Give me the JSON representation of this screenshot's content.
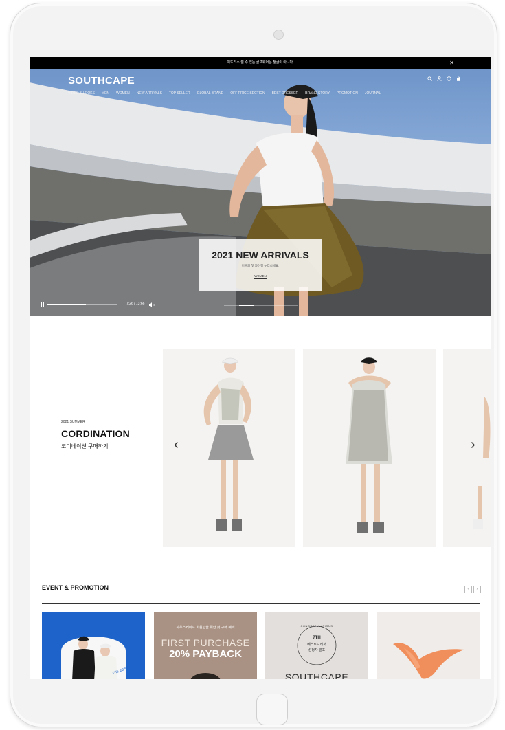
{
  "topbar": {
    "notice": "이드리스 쉴 수 있는 골프웨어는 정글이 아니다.",
    "close": "✕"
  },
  "header": {
    "logo": "SOUTHCAPE",
    "nav": [
      "VIDEO & LOOKS",
      "MEN",
      "WOMEN",
      "NEW ARRIVALS",
      "TOP SELLER",
      "GLOBAL BRAND",
      "OFF PRICE SECTION",
      "BEST DRESSER",
      "BRAND STORY",
      "PROMOTION",
      "JOURNAL"
    ],
    "icons": [
      "search-icon",
      "user-icon",
      "help-icon",
      "bag-icon"
    ]
  },
  "hero": {
    "title": "2021 NEW ARRIVALS",
    "subtitle": "이윤의 첫 와이행 누리시세요.",
    "link": "WOMEN",
    "time": "7:26 / 13:66",
    "video_progress": 0.56,
    "slide_position": 0.2
  },
  "coordination": {
    "season": "2021 SUMMER",
    "title": "CORDINATION",
    "subtitle_kr": "코디네이션 구매하기",
    "progress": 0.33,
    "prev_arrow": "‹",
    "next_arrow": "›"
  },
  "event": {
    "title": "EVENT & PROMOTION",
    "prev": "‹",
    "next": "›",
    "card2": {
      "small": "사우스케이프 회원만을 위한 첫 구매 혜택",
      "line1": "FIRST PURCHASE",
      "line2": "20% PAYBACK"
    },
    "card3": {
      "badge_top": "CONGRATULATIONS",
      "badge_mid": "7TH",
      "badge_kr1": "베스트드레서",
      "badge_kr2": "선정자 발표",
      "brand": "SOUTHCAPE"
    },
    "card1": {
      "tag": "THE BEST"
    }
  },
  "colors": {
    "topbar": "#000000",
    "event_blue": "#1d63c9",
    "event_taupe": "#a99283",
    "event_grey": "#e2dfdc",
    "event_light": "#efecea",
    "accent_orange": "#f08f5b"
  }
}
